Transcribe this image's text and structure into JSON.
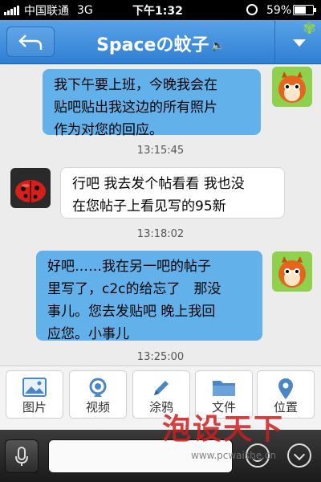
{
  "status_bar": {
    "carrier": "中国联通",
    "network": "3G",
    "time": "下午1:32",
    "battery": "59%"
  },
  "nav": {
    "back_icon": "back-arrow-icon",
    "title": "Spaceの蚊子",
    "sound_icon": "speaker-icon",
    "menu_icon": "chevron-down-icon"
  },
  "messages": [
    {
      "side": "out",
      "text_lines": [
        "我下午要上班，今晚我会在",
        "贴吧贴出我这边的所有照片",
        "作为对您的回应。"
      ]
    },
    {
      "timestamp": "13:15:45"
    },
    {
      "side": "in",
      "text_lines": [
        "行吧 我去发个帖看看 我也没",
        "在您帖子上看见写的95新"
      ]
    },
    {
      "timestamp": "13:18:02"
    },
    {
      "side": "out",
      "text_lines": [
        "好吧……我在另一吧的帖子",
        "里写了，c2c的给忘了　那没",
        "事儿。您去发贴吧  晚上我回",
        "应您。小事儿"
      ]
    },
    {
      "timestamp": "13:25:00"
    }
  ],
  "actions": [
    {
      "label": "图片",
      "icon": "image-icon"
    },
    {
      "label": "视频",
      "icon": "video-icon"
    },
    {
      "label": "涂鸦",
      "icon": "pencil-icon"
    },
    {
      "label": "文件",
      "icon": "folder-icon"
    },
    {
      "label": "位置",
      "icon": "location-pin-icon"
    }
  ],
  "input_bar": {
    "mic_icon": "microphone-icon",
    "emoji_icon": "smiley-icon",
    "expand_icon": "chevron-down-circle-icon"
  },
  "watermark": {
    "title": "泡设天下",
    "url": "www.pcwaishe.cn"
  },
  "colors": {
    "nav_blue": "#3a89dc",
    "bubble_out": "#63b1ea",
    "bubble_in": "#ffffff"
  }
}
